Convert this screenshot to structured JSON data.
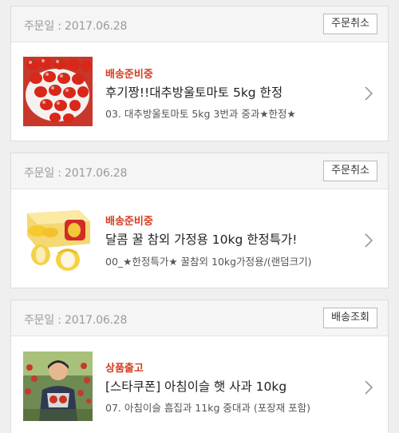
{
  "orders": [
    {
      "date_label": "주문일 : 2017.06.28",
      "action_label": "주문취소",
      "status": "배송준비중",
      "title": "후기짱!!대추방울토마토 5kg 한정",
      "option": "03. 대추방울토마토 5kg 3번과 중과★한정★",
      "thumbnail_icon": "cherry-tomatoes-image"
    },
    {
      "date_label": "주문일 : 2017.06.28",
      "action_label": "주문취소",
      "status": "배송준비중",
      "title": "달콤 꿀 참외 가정용 10kg 한정특가!",
      "option": "00_★한정특가★ 꿀참외 10kg가정용/(랜덤크기)",
      "thumbnail_icon": "korean-melon-box-image"
    },
    {
      "date_label": "주문일 : 2017.06.28",
      "action_label": "배송조회",
      "status": "상품출고",
      "title": "[스타쿠폰] 아침이슬 햇 사과 10kg",
      "option": "07. 아침이슬 흠집과 11kg 중대과 (포장재 포함)",
      "thumbnail_icon": "apple-farmer-photo"
    }
  ],
  "colors": {
    "status_red": "#d63b1f",
    "background": "#efefef",
    "header_bg": "#f5f5f5"
  }
}
